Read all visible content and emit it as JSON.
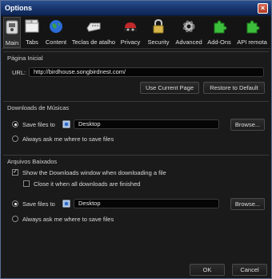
{
  "window": {
    "title": "Options",
    "close_glyph": "×"
  },
  "toolbar": {
    "items": [
      {
        "label": "Main",
        "icon": "switch-icon",
        "selected": true
      },
      {
        "label": "Tabs",
        "icon": "tabs-icon"
      },
      {
        "label": "Content",
        "icon": "globe-icon"
      },
      {
        "label": "Teclas de atalho",
        "icon": "keyboard-icon"
      },
      {
        "label": "Privacy",
        "icon": "privacy-icon"
      },
      {
        "label": "Security",
        "icon": "lock-icon"
      },
      {
        "label": "Advanced",
        "icon": "gear-icon"
      },
      {
        "label": "Add-Ons",
        "icon": "puzzle-icon"
      },
      {
        "label": "API remota",
        "icon": "remote-api-icon"
      }
    ]
  },
  "homepage": {
    "title": "Página Inicial",
    "url_label": "URL:",
    "url_value": "http://birdhouse.songbirdnest.com/",
    "use_current": "Use Current Page",
    "restore_default": "Restore to Default"
  },
  "music_downloads": {
    "title": "Downloads de Músicas",
    "save_files_to": "Save files to",
    "folder": "Desktop",
    "browse": "Browse...",
    "always_ask": "Always ask me where to save files"
  },
  "file_downloads": {
    "title": "Arquivos Baixados",
    "show_downloads_window": "Show the Downloads window when downloading a file",
    "close_when_finished": "Close it when all downloads are finished",
    "save_files_to": "Save files to",
    "folder": "Desktop",
    "browse": "Browse...",
    "always_ask": "Always ask me where to save files"
  },
  "footer": {
    "ok": "OK",
    "cancel": "Cancel"
  }
}
